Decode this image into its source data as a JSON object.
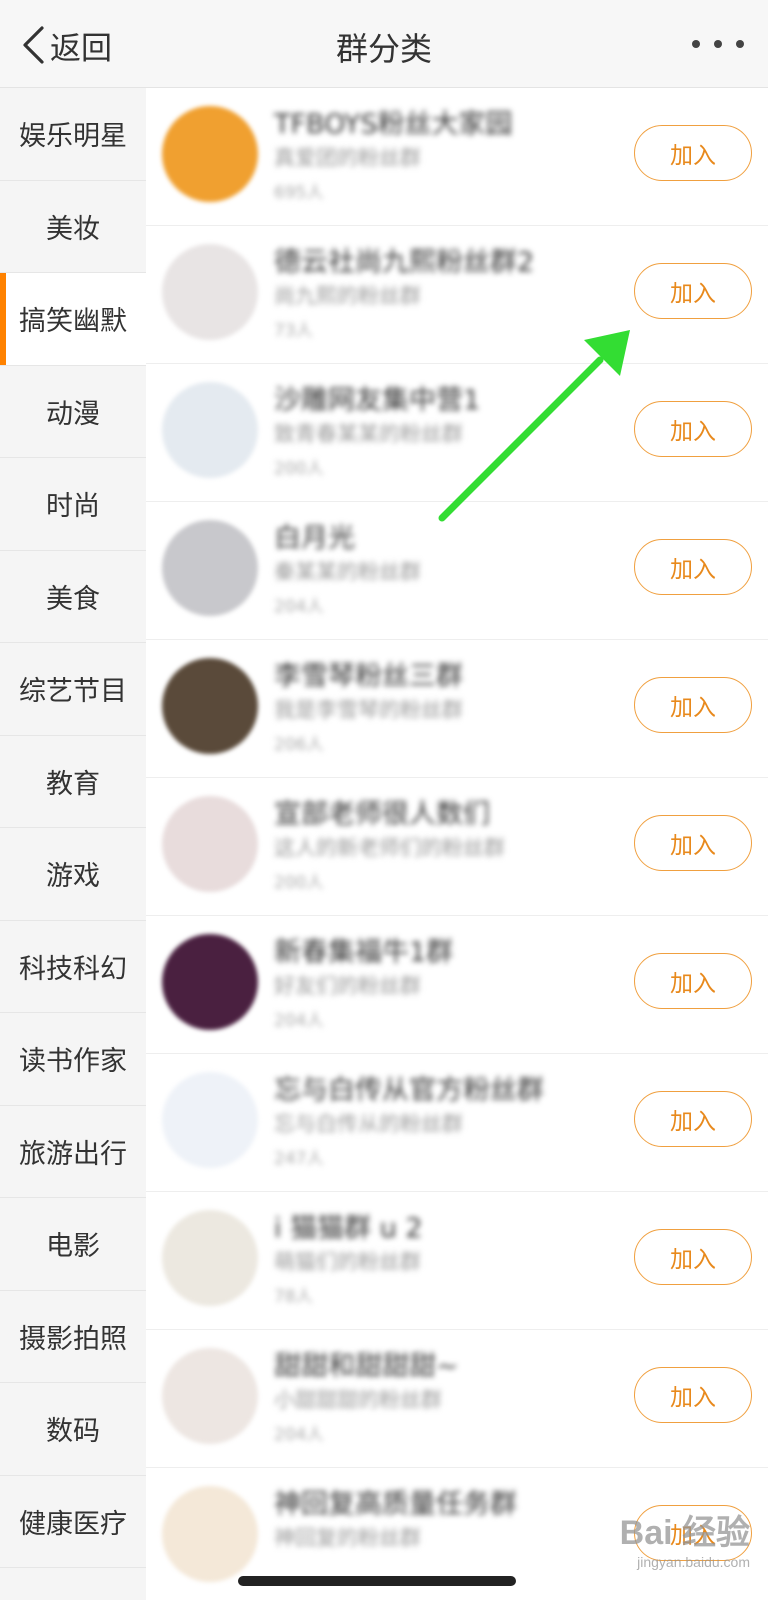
{
  "header": {
    "back_label": "返回",
    "title": "群分类"
  },
  "sidebar": {
    "items": [
      {
        "label": "娱乐明星",
        "active": false
      },
      {
        "label": "美妆",
        "active": false
      },
      {
        "label": "搞笑幽默",
        "active": true
      },
      {
        "label": "动漫",
        "active": false
      },
      {
        "label": "时尚",
        "active": false
      },
      {
        "label": "美食",
        "active": false
      },
      {
        "label": "综艺节目",
        "active": false
      },
      {
        "label": "教育",
        "active": false
      },
      {
        "label": "游戏",
        "active": false
      },
      {
        "label": "科技科幻",
        "active": false
      },
      {
        "label": "读书作家",
        "active": false
      },
      {
        "label": "旅游出行",
        "active": false
      },
      {
        "label": "电影",
        "active": false
      },
      {
        "label": "摄影拍照",
        "active": false
      },
      {
        "label": "数码",
        "active": false
      },
      {
        "label": "健康医疗",
        "active": false
      }
    ]
  },
  "groups": [
    {
      "name": "TFBOYS粉丝大家园",
      "desc": "真爱团的粉丝群",
      "count": "695人",
      "join_label": "加入",
      "avatar_color": "#f0a030"
    },
    {
      "name": "德云社尚九熙粉丝群2",
      "desc": "尚九熙的粉丝群",
      "count": "73人",
      "join_label": "加入",
      "avatar_color": "#e8e4e4"
    },
    {
      "name": "沙雕网友集中营1",
      "desc": "致青春某某的粉丝群",
      "count": "200人",
      "join_label": "加入",
      "avatar_color": "#e4eaf0"
    },
    {
      "name": "白月光",
      "desc": "秦某某的粉丝群",
      "count": "204人",
      "join_label": "加入",
      "avatar_color": "#c8c8cc"
    },
    {
      "name": "李雪琴粉丝三群",
      "desc": "我是李雪琴的粉丝群",
      "count": "206人",
      "join_label": "加入",
      "avatar_color": "#5a4a3a"
    },
    {
      "name": "宣部老师很人数们",
      "desc": "这人的新老师们的粉丝群",
      "count": "200人",
      "join_label": "加入",
      "avatar_color": "#e8dcdc"
    },
    {
      "name": "新春集福牛1群",
      "desc": "好友们的粉丝群",
      "count": "204人",
      "join_label": "加入",
      "avatar_color": "#4a2040"
    },
    {
      "name": "忘与白传从官方粉丝群",
      "desc": "忘与白传从的粉丝群",
      "count": "247人",
      "join_label": "加入",
      "avatar_color": "#eef2f8"
    },
    {
      "name": "i 猫猫群 u 2",
      "desc": "萌猫们的粉丝群",
      "count": "78人",
      "join_label": "加入",
      "avatar_color": "#ece8e0"
    },
    {
      "name": "甜甜和甜甜甜~",
      "desc": "小甜甜甜的粉丝群",
      "count": "204人",
      "join_label": "加入",
      "avatar_color": "#ede6e2"
    },
    {
      "name": "神回复高质量任务群",
      "desc": "神回复的粉丝群",
      "count": "",
      "join_label": "加入",
      "avatar_color": "#f4e8d8"
    }
  ],
  "watermark": {
    "main": "Bai 经验",
    "sub": "jingyan.baidu.com"
  },
  "colors": {
    "accent": "#ff8200",
    "join_border": "#f0a040",
    "join_text": "#e8891c",
    "annotation_arrow": "#33dd33"
  }
}
